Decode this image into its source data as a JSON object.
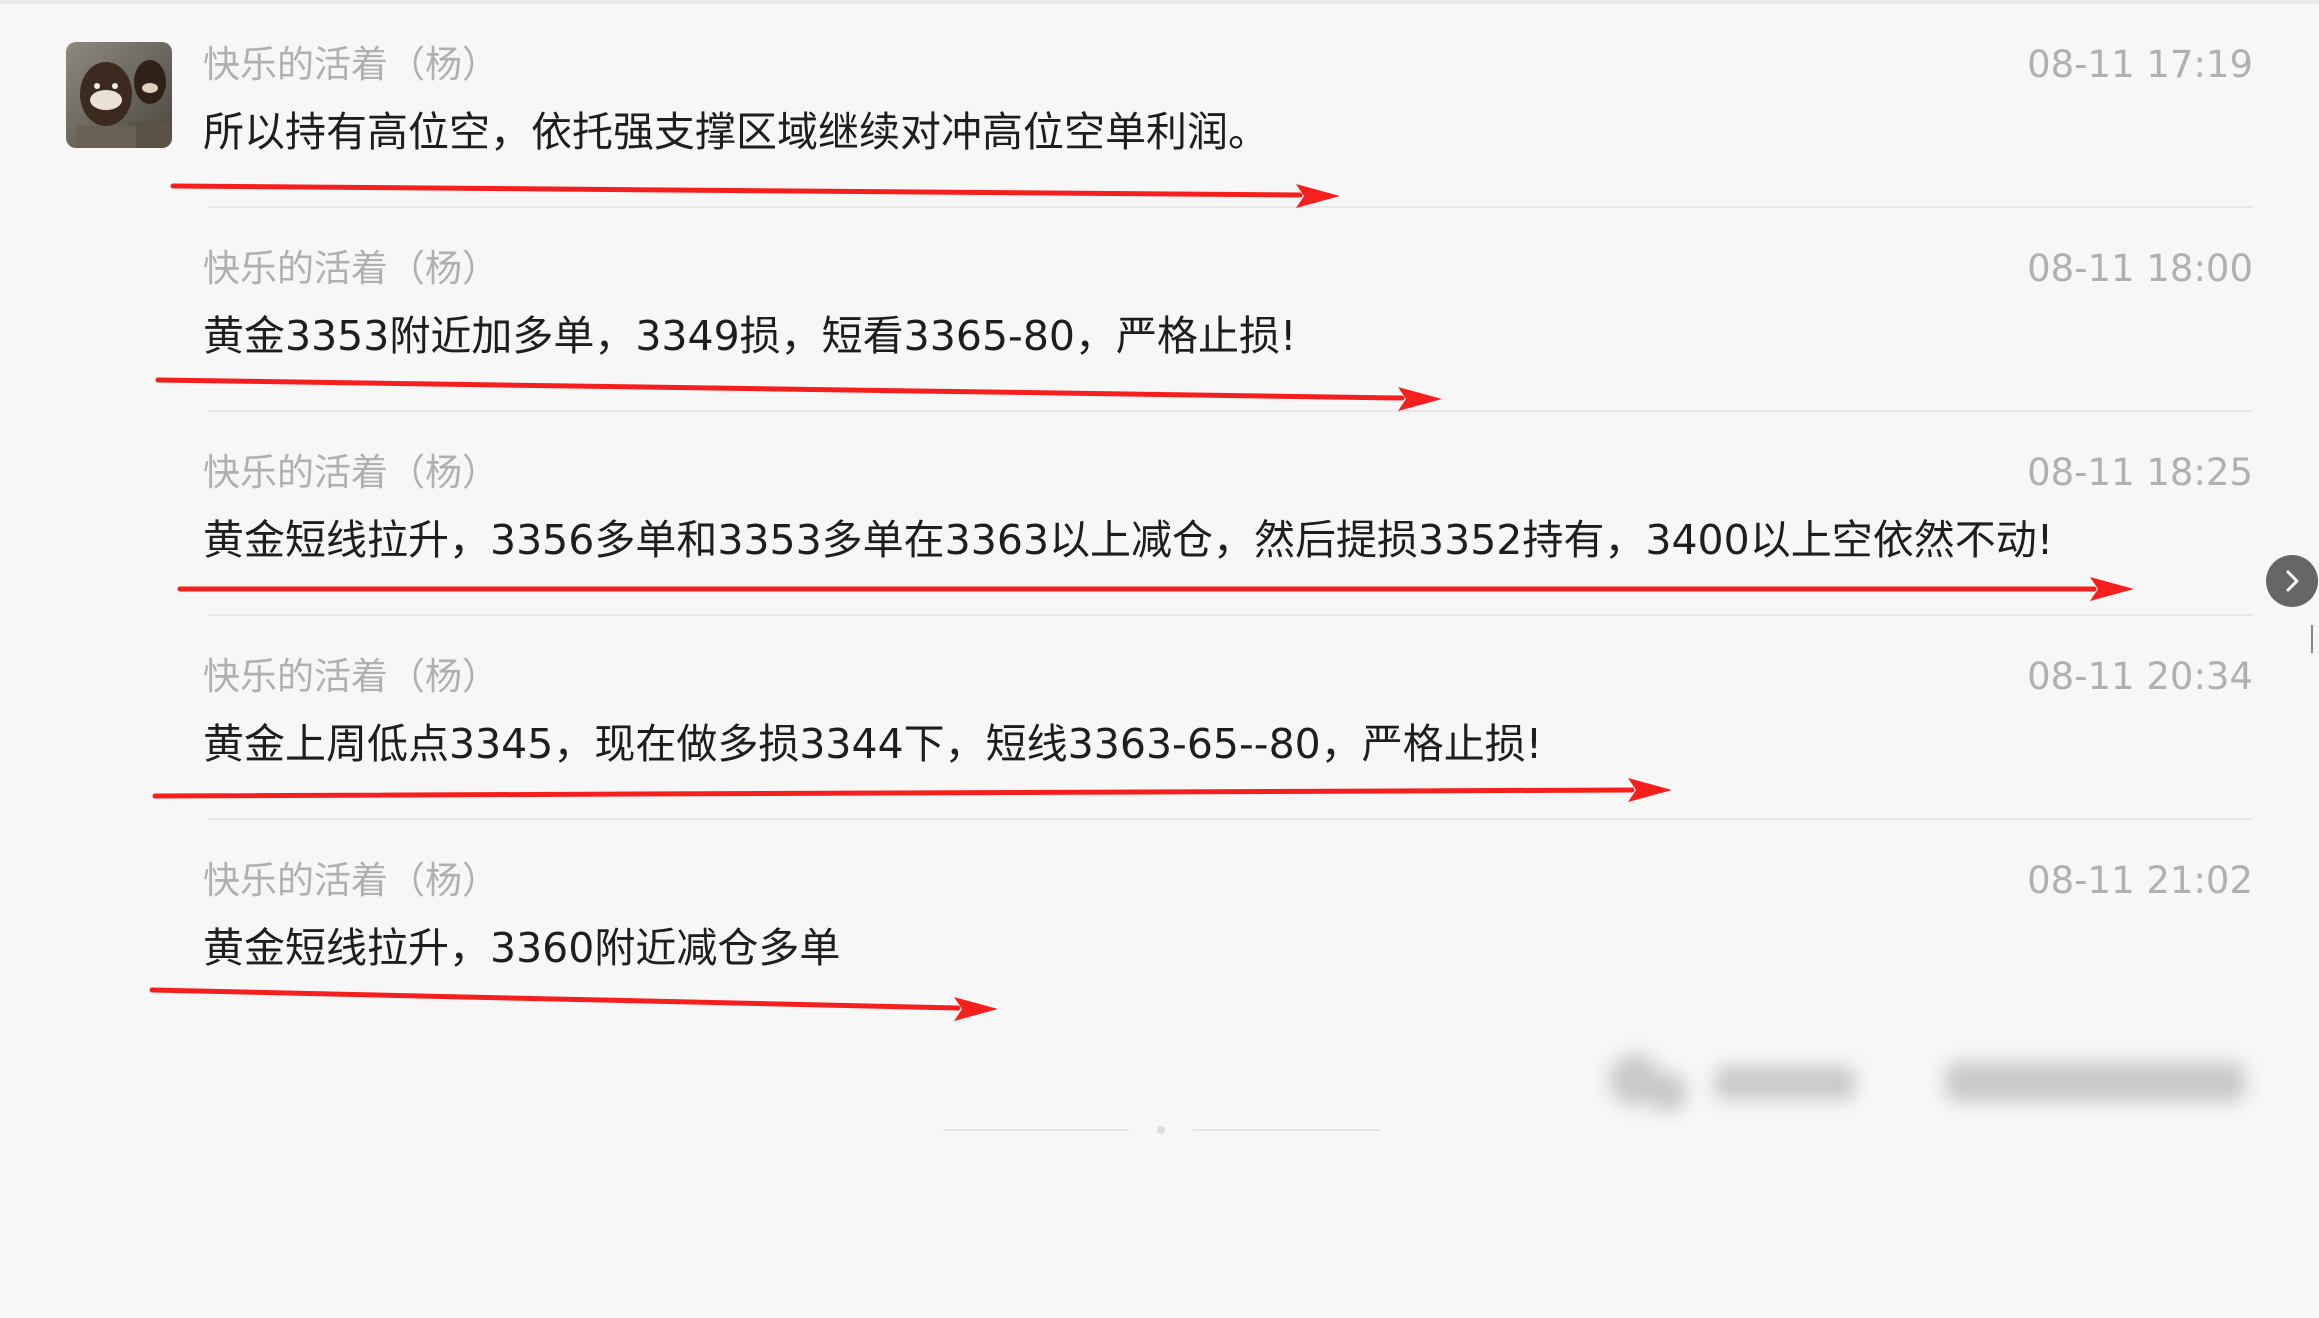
{
  "messages": [
    {
      "name": "快乐的活着（杨）",
      "time": "08-11 17:19",
      "text": "所以持有高位空，依托强支撑区域继续对冲高位空单利润。"
    },
    {
      "name": "快乐的活着（杨）",
      "time": "08-11 18:00",
      "text": "黄金3353附近加多单，3349损，短看3365-80，严格止损!"
    },
    {
      "name": "快乐的活着（杨）",
      "time": "08-11 18:25",
      "text": "黄金短线拉升，3356多单和3353多单在3363以上减仓，然后提损3352持有，3400以上空依然不动!"
    },
    {
      "name": "快乐的活着（杨）",
      "time": "08-11 20:34",
      "text": "黄金上周低点3345，现在做多损3344下，短线3363-65--80，严格止损!"
    },
    {
      "name": "快乐的活着（杨）",
      "time": "08-11 21:02",
      "text": "黄金短线拉升，3360附近减仓多单"
    }
  ],
  "colors": {
    "background": "#f7f7f7",
    "name_text": "#b0b0b0",
    "message_text": "#1e1e1e",
    "annotation_arrow": "#f5201e",
    "divider": "#e8e8e8"
  },
  "icons": {
    "avatar": "avatar-photo",
    "next": "chevron-right-icon",
    "arrow": "red-arrow-annotation"
  }
}
